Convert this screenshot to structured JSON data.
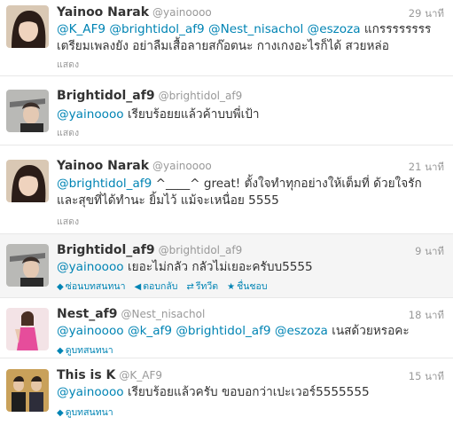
{
  "tweets": [
    {
      "name": "Yainoo Narak",
      "handle": "@yainoooo",
      "time": "29 นาที",
      "mentions": [
        "@K_AF9",
        "@brightidol_af9",
        "@Nest_nisachol",
        "@eszoza"
      ],
      "text": "แกรรรรรรรร เตรียมเพลงยัง อย่าลืมเสื้อลายสก๊อตนะ กางเกงอะไรก็ได้ สวยหล่อ",
      "footer": "แสดง"
    },
    {
      "name": "Brightidol_af9",
      "handle": "@brightidol_af9",
      "time": "",
      "mentions": [
        "@yainoooo"
      ],
      "text": "เรียบร้อยยแล้วค้าบบพี่เป้า",
      "footer": "แสดง"
    },
    {
      "name": "Yainoo Narak",
      "handle": "@yainoooo",
      "time": "21 นาที",
      "mentions": [
        "@brightidol_af9"
      ],
      "text": "^____^ great! ตั้งใจทำทุกอย่างให้เต็มที่ ด้วยใจรักและสุขที่ได้ทำนะ ยิ้มไว้ แม้จะเหนื่อย 5555",
      "footer": "แสดง"
    },
    {
      "name": "Brightidol_af9",
      "handle": "@brightidol_af9",
      "time": "9 นาที",
      "mentions": [
        "@yainoooo"
      ],
      "text": "เยอะไม่กลัว กลัวไม่เยอะครับบ5555",
      "actions": {
        "hide": "ซ่อนบทสนทนา",
        "reply": "ตอบกลับ",
        "retweet": "รีทวีต",
        "favorite": "ชื่นชอบ"
      }
    },
    {
      "name": "Nest_af9",
      "handle": "@Nest_nisachol",
      "time": "18 นาที",
      "mentions": [
        "@yainoooo",
        "@k_af9",
        "@brightidol_af9",
        "@eszoza"
      ],
      "text": "เนสด้วยหรอคะ",
      "footer": "ดูบทสนทนา"
    },
    {
      "name": "This is K",
      "handle": "@K_AF9",
      "time": "15 นาที",
      "mentions": [
        "@yainoooo"
      ],
      "text": "เรียบร้อยแล้วครับ ขอบอกว่าเปะเวอร์5555555",
      "footer": "ดูบทสนทนา"
    }
  ],
  "colors": {
    "link": "#0084b4",
    "muted": "#999999",
    "text": "#333333"
  }
}
